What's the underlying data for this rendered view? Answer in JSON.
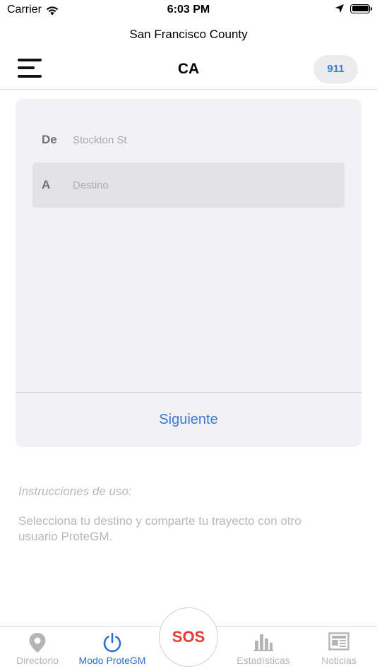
{
  "status_bar": {
    "carrier": "Carrier",
    "time": "6:03 PM"
  },
  "location": {
    "county": "San Francisco County"
  },
  "header": {
    "title": "CA",
    "emergency_label": "911",
    "menu_icon": "hamburger-menu-icon"
  },
  "route": {
    "from_label": "De",
    "from_value": "Stockton St",
    "to_label": "A",
    "to_placeholder": "Destino",
    "next_label": "Siguiente"
  },
  "instructions": {
    "title": "Instrucciones de uso:",
    "body": "Selecciona tu destino y comparte tu trayecto con otro usuario ProteGM."
  },
  "tabs": [
    {
      "label": "Directorio",
      "icon": "location-pin-icon",
      "active": false
    },
    {
      "label": "Modo ProteGM",
      "icon": "power-icon",
      "active": true
    },
    {
      "label": "SOS",
      "icon": "sos-button",
      "active": false
    },
    {
      "label": "Estadísticas",
      "icon": "bar-chart-icon",
      "active": false
    },
    {
      "label": "Noticias",
      "icon": "newspaper-icon",
      "active": false
    }
  ],
  "colors": {
    "accent": "#3a78d6",
    "sos": "#e83a3a",
    "inactive": "#b5b5b5",
    "card_bg": "#f2f2f4"
  }
}
